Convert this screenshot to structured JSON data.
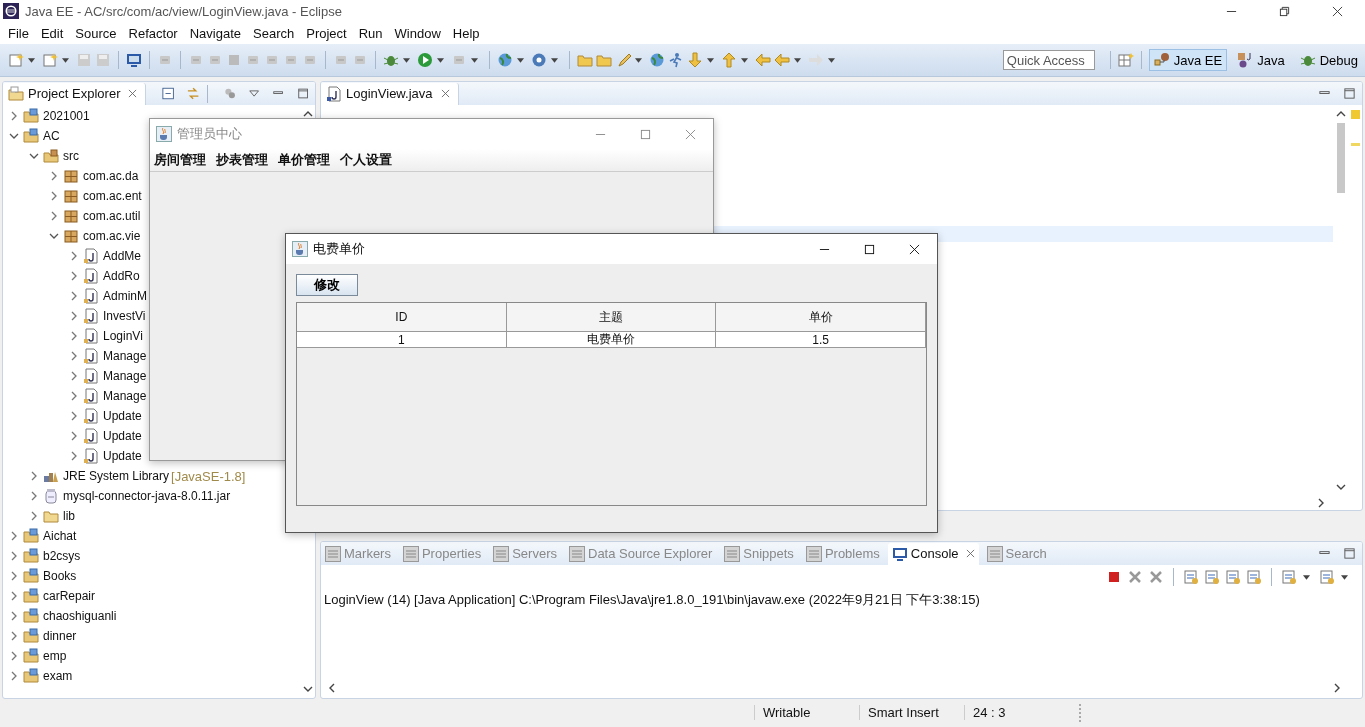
{
  "window": {
    "title": "Java EE - AC/src/com/ac/view/LoginView.java - Eclipse"
  },
  "menu": [
    "File",
    "Edit",
    "Source",
    "Refactor",
    "Navigate",
    "Search",
    "Project",
    "Run",
    "Window",
    "Help"
  ],
  "quick_access": {
    "placeholder": "Quick Access"
  },
  "perspectives": [
    {
      "label": "Java EE",
      "selected": true,
      "kind": "javaee"
    },
    {
      "label": "Java",
      "selected": false,
      "kind": "java"
    },
    {
      "label": "Debug",
      "selected": false,
      "kind": "debug"
    }
  ],
  "project_explorer": {
    "title": "Project Explorer",
    "tree": [
      {
        "label": "2021001",
        "kind": "project",
        "expanded": false
      },
      {
        "label": "AC",
        "kind": "project",
        "expanded": true,
        "children": [
          {
            "label": "src",
            "kind": "source-folder",
            "expanded": true,
            "children": [
              {
                "label": "com.ac.da",
                "kind": "package",
                "expanded": false
              },
              {
                "label": "com.ac.ent",
                "kind": "package",
                "expanded": false
              },
              {
                "label": "com.ac.util",
                "kind": "package",
                "expanded": false
              },
              {
                "label": "com.ac.vie",
                "kind": "package",
                "expanded": true,
                "children": [
                  {
                    "label": "AddMe",
                    "kind": "java-file",
                    "expanded": false
                  },
                  {
                    "label": "AddRo",
                    "kind": "java-file",
                    "expanded": false
                  },
                  {
                    "label": "AdminM",
                    "kind": "java-file",
                    "expanded": false
                  },
                  {
                    "label": "InvestVi",
                    "kind": "java-file",
                    "expanded": false
                  },
                  {
                    "label": "LoginVi",
                    "kind": "java-file",
                    "expanded": false
                  },
                  {
                    "label": "Manage",
                    "kind": "java-file",
                    "expanded": false
                  },
                  {
                    "label": "Manage",
                    "kind": "java-file",
                    "expanded": false
                  },
                  {
                    "label": "Manage",
                    "kind": "java-file",
                    "expanded": false
                  },
                  {
                    "label": "Update",
                    "kind": "java-file",
                    "expanded": false
                  },
                  {
                    "label": "Update",
                    "kind": "java-file",
                    "expanded": false
                  },
                  {
                    "label": "Update",
                    "kind": "java-file",
                    "expanded": false
                  }
                ]
              }
            ]
          },
          {
            "label": "JRE System Library",
            "suffix": "[JavaSE-1.8]",
            "kind": "library",
            "expanded": false
          },
          {
            "label": "mysql-connector-java-8.0.11.jar",
            "kind": "jar",
            "expanded": false
          },
          {
            "label": "lib",
            "kind": "folder",
            "expanded": false
          }
        ]
      },
      {
        "label": "Aichat",
        "kind": "project",
        "expanded": false
      },
      {
        "label": "b2csys",
        "kind": "project",
        "expanded": false
      },
      {
        "label": "Books",
        "kind": "project",
        "expanded": false
      },
      {
        "label": "carRepair",
        "kind": "project",
        "expanded": false
      },
      {
        "label": "chaoshiguanli",
        "kind": "project",
        "expanded": false
      },
      {
        "label": "dinner",
        "kind": "project",
        "expanded": false
      },
      {
        "label": "emp",
        "kind": "project",
        "expanded": false
      },
      {
        "label": "exam",
        "kind": "project",
        "expanded": false
      }
    ]
  },
  "editor": {
    "tabs": [
      {
        "label": "LoginView.java",
        "selected": true
      }
    ]
  },
  "bottom_panel": {
    "tabs": [
      {
        "label": "Markers",
        "selected": false
      },
      {
        "label": "Properties",
        "selected": false
      },
      {
        "label": "Servers",
        "selected": false
      },
      {
        "label": "Data Source Explorer",
        "selected": false
      },
      {
        "label": "Snippets",
        "selected": false
      },
      {
        "label": "Problems",
        "selected": false
      },
      {
        "label": "Console",
        "selected": true
      },
      {
        "label": "Search",
        "selected": false
      }
    ],
    "console_line": "LoginView (14) [Java Application] C:\\Program Files\\Java\\jre1.8.0_191\\bin\\javaw.exe (2022年9月21日 下午3:38:15)"
  },
  "status_bar": [
    "Writable",
    "Smart Insert",
    "24 : 3"
  ],
  "admin_window": {
    "title": "管理员中心",
    "active": false,
    "menus": [
      "房间管理",
      "抄表管理",
      "单价管理",
      "个人设置"
    ]
  },
  "price_dialog": {
    "title": "电费单价",
    "active": true,
    "button": "修改",
    "columns": [
      "ID",
      "主题",
      "单价"
    ],
    "rows": [
      [
        "1",
        "电费单价",
        "1.5"
      ]
    ]
  }
}
